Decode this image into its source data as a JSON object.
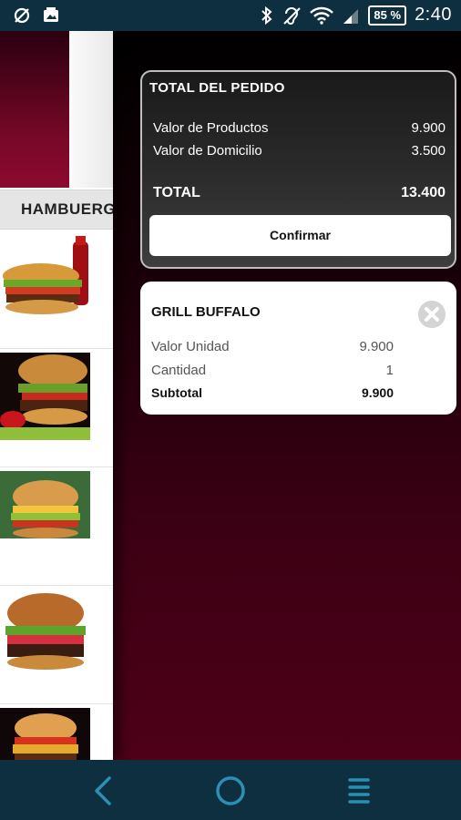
{
  "status_bar": {
    "battery": "85 %",
    "time": "2:40",
    "icons": [
      "sync-off-icon",
      "image-icon",
      "bluetooth-icon",
      "hearing-aid-icon",
      "wifi-icon",
      "signal-icon",
      "battery-icon"
    ]
  },
  "menu": {
    "category": "HAMBUERGUESAS"
  },
  "order_total": {
    "title": "TOTAL DEL PEDIDO",
    "products_label": "Valor de Productos",
    "products_value": "9.900",
    "delivery_label": "Valor de Domicilio",
    "delivery_value": "3.500",
    "total_label": "TOTAL",
    "total_value": "13.400",
    "confirm_label": "Confirmar"
  },
  "order_item": {
    "name": "GRILL BUFFALO",
    "unit_label": "Valor Unidad",
    "unit_value": "9.900",
    "qty_label": "Cantidad",
    "qty_value": "1",
    "subtotal_label": "Subtotal",
    "subtotal_value": "9.900"
  },
  "nav": {
    "icons": [
      "back-icon",
      "home-icon",
      "menu-icon"
    ]
  },
  "colors": {
    "system_bar": "#0d2f3f",
    "nav_icon": "#2a8fb3",
    "accent_red": "#5a001c"
  }
}
